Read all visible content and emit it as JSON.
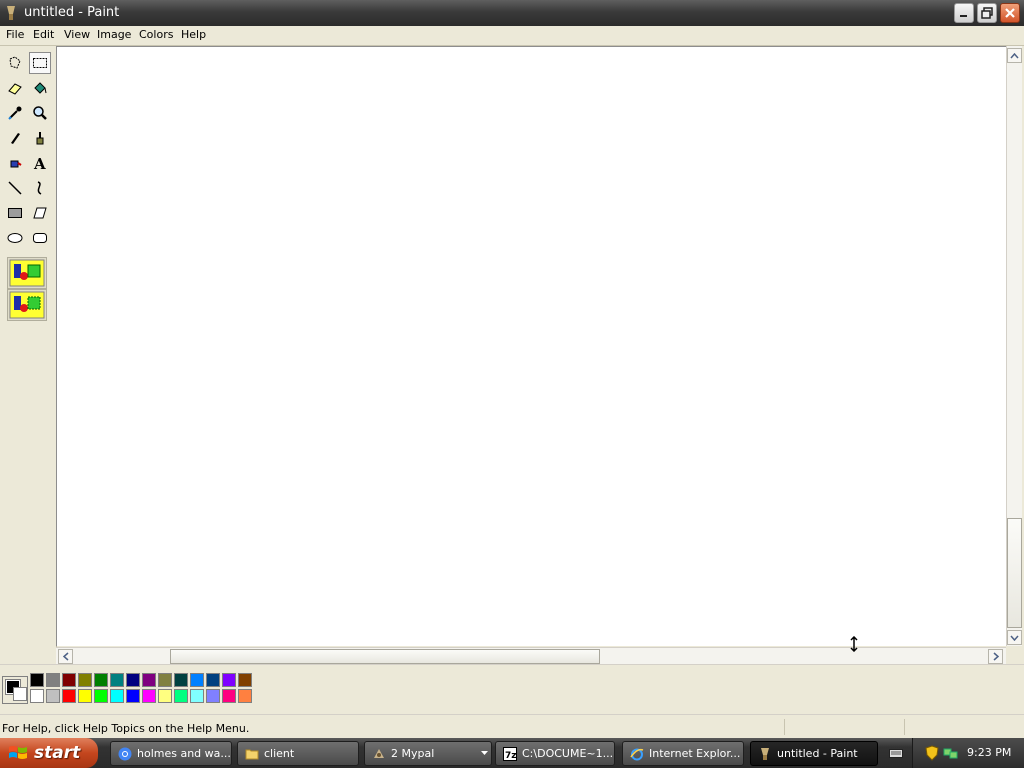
{
  "window": {
    "title": "untitled - Paint",
    "icon": "paint-brush-icon"
  },
  "menu": [
    "File",
    "Edit",
    "View",
    "Image",
    "Colors",
    "Help"
  ],
  "tools": [
    {
      "name": "free-form-select",
      "icon": "free-form-select-icon"
    },
    {
      "name": "rectangle-select",
      "icon": "rectangle-select-icon",
      "selected": true
    },
    {
      "name": "eraser",
      "icon": "eraser-icon"
    },
    {
      "name": "fill-with-color",
      "icon": "fill-bucket-icon"
    },
    {
      "name": "pick-color",
      "icon": "eyedropper-icon"
    },
    {
      "name": "magnifier",
      "icon": "magnifier-icon"
    },
    {
      "name": "pencil",
      "icon": "pencil-icon"
    },
    {
      "name": "brush",
      "icon": "brush-icon"
    },
    {
      "name": "airbrush",
      "icon": "airbrush-icon"
    },
    {
      "name": "text",
      "icon": "text-icon"
    },
    {
      "name": "line",
      "icon": "line-icon"
    },
    {
      "name": "curve",
      "icon": "curve-icon"
    },
    {
      "name": "rectangle",
      "icon": "rectangle-icon"
    },
    {
      "name": "polygon",
      "icon": "polygon-icon"
    },
    {
      "name": "ellipse",
      "icon": "ellipse-icon"
    },
    {
      "name": "rounded-rectangle",
      "icon": "rounded-rectangle-icon"
    }
  ],
  "tool_options": [
    "opaque-selection-icon",
    "transparent-selection-icon"
  ],
  "palette": {
    "foreground": "#000000",
    "background": "#ffffff",
    "top_row": [
      "#000000",
      "#808080",
      "#800000",
      "#808000",
      "#008000",
      "#008080",
      "#000080",
      "#800080",
      "#808040",
      "#004040",
      "#0080ff",
      "#004080",
      "#8000ff",
      "#804000"
    ],
    "bottom_row": [
      "#ffffff",
      "#c0c0c0",
      "#ff0000",
      "#ffff00",
      "#00ff00",
      "#00ffff",
      "#0000ff",
      "#ff00ff",
      "#ffff80",
      "#00ff80",
      "#80ffff",
      "#8080ff",
      "#ff0080",
      "#ff8040"
    ]
  },
  "status": {
    "help_text": "For Help, click Help Topics on the Help Menu."
  },
  "taskbar": {
    "start_label": "start",
    "tasks": [
      {
        "label": "holmes and wa...",
        "icon": "chrome-icon"
      },
      {
        "label": "client",
        "icon": "folder-icon"
      },
      {
        "label": "2 Mypal",
        "icon": "mypal-icon"
      },
      {
        "label": "C:\\DOCUME~1...",
        "icon": "7zip-icon"
      },
      {
        "label": "Internet Explor...",
        "icon": "internet-explorer-icon"
      },
      {
        "label": "untitled - Paint",
        "icon": "paint-brush-icon",
        "active": true
      }
    ],
    "tray_icons": [
      "keyboard-icon",
      "security-shield-icon",
      "network-icon"
    ],
    "time": "9:23 PM"
  }
}
